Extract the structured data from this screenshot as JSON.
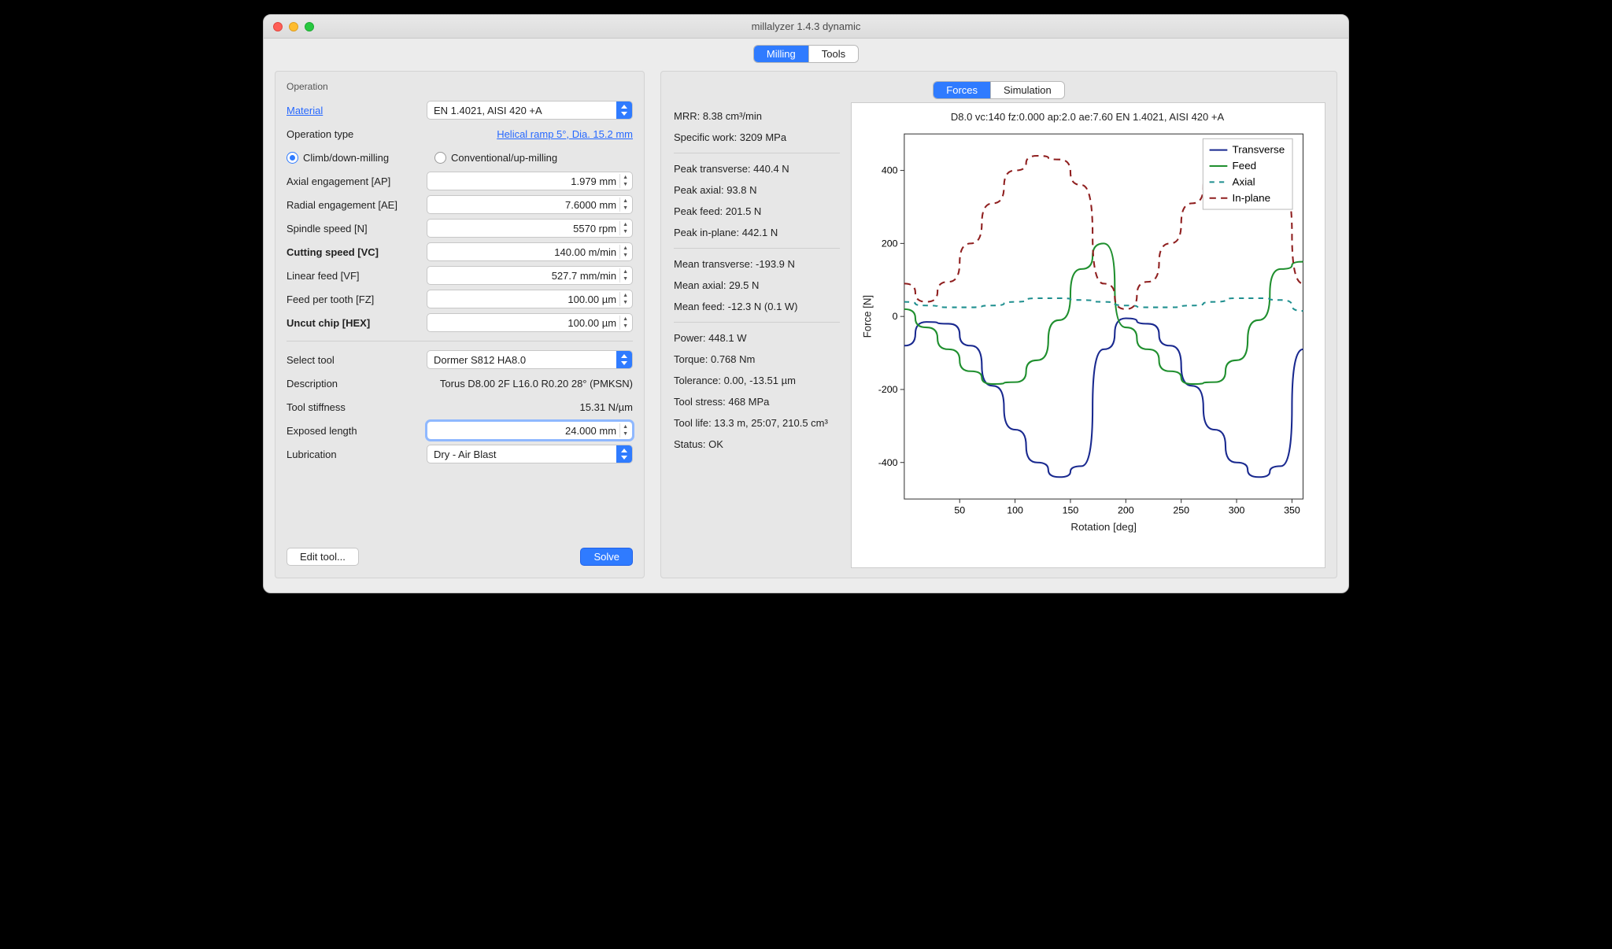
{
  "window": {
    "title": "millalyzer 1.4.3 dynamic"
  },
  "main_tabs": {
    "milling": "Milling",
    "tools": "Tools"
  },
  "sub_tabs": {
    "forces": "Forces",
    "simulation": "Simulation"
  },
  "section": {
    "operation": "Operation"
  },
  "left": {
    "material_label": "Material",
    "material_value": "EN 1.4021, AISI 420 +A",
    "op_type_label": "Operation type",
    "op_type_link": "Helical ramp 5°, Dia. 15.2 mm",
    "radio_climb": "Climb/down-milling",
    "radio_conventional": "Conventional/up-milling",
    "ap_label": "Axial engagement [AP]",
    "ap_value": "1.979 mm",
    "ae_label": "Radial engagement [AE]",
    "ae_value": "7.6000 mm",
    "n_label": "Spindle speed [N]",
    "n_value": "5570 rpm",
    "vc_label": "Cutting speed [VC]",
    "vc_value": "140.00 m/min",
    "vf_label": "Linear feed [VF]",
    "vf_value": "527.7 mm/min",
    "fz_label": "Feed per tooth [FZ]",
    "fz_value": "100.00 µm",
    "hex_label": "Uncut chip [HEX]",
    "hex_value": "100.00 µm",
    "select_tool_label": "Select tool",
    "select_tool_value": "Dormer S812 HA8.0",
    "desc_label": "Description",
    "desc_value": "Torus D8.00 2F L16.0 R0.20 28° (PMKSN)",
    "stiffness_label": "Tool stiffness",
    "stiffness_value": "15.31 N/µm",
    "exposed_label": "Exposed length",
    "exposed_value": "24.000 mm",
    "lub_label": "Lubrication",
    "lub_value": "Dry - Air Blast",
    "edit_tool_btn": "Edit tool...",
    "solve_btn": "Solve"
  },
  "stats": {
    "mrr": "MRR: 8.38 cm³/min",
    "spec_work": "Specific work: 3209 MPa",
    "peak_trans": "Peak transverse: 440.4 N",
    "peak_axial": "Peak axial: 93.8 N",
    "peak_feed": "Peak feed: 201.5 N",
    "peak_inplane": "Peak in-plane: 442.1 N",
    "mean_trans": "Mean transverse: -193.9 N",
    "mean_axial": "Mean axial: 29.5 N",
    "mean_feed": "Mean feed: -12.3 N (0.1 W)",
    "power": "Power: 448.1 W",
    "torque": "Torque: 0.768 Nm",
    "tolerance": "Tolerance: 0.00, -13.51 µm",
    "tool_stress": "Tool stress: 468 MPa",
    "tool_life": "Tool life: 13.3 m, 25:07, 210.5 cm³",
    "status": "Status: OK"
  },
  "chart": {
    "title": "D8.0 vc:140 fz:0.000 ap:2.0 ae:7.60 EN 1.4021, AISI 420 +A",
    "xlabel": "Rotation [deg]",
    "ylabel": "Force [N]",
    "legend": {
      "transverse": "Transverse",
      "feed": "Feed",
      "axial": "Axial",
      "inplane": "In-plane"
    }
  },
  "chart_data": {
    "type": "line",
    "xlabel": "Rotation [deg]",
    "ylabel": "Force [N]",
    "xlim": [
      0,
      360
    ],
    "ylim": [
      -500,
      500
    ],
    "xticks": [
      50,
      100,
      150,
      200,
      250,
      300,
      350
    ],
    "yticks": [
      -400,
      -200,
      0,
      200,
      400
    ],
    "x": [
      0,
      20,
      40,
      60,
      80,
      100,
      120,
      140,
      160,
      180,
      200,
      220,
      240,
      260,
      280,
      300,
      320,
      340,
      360
    ],
    "series": [
      {
        "name": "Transverse",
        "color": "#19298f",
        "dash": "",
        "values": [
          -80,
          -15,
          -20,
          -80,
          -190,
          -310,
          -400,
          -440,
          -410,
          -90,
          -5,
          -20,
          -80,
          -190,
          -310,
          -400,
          -440,
          -410,
          -90
        ]
      },
      {
        "name": "Feed",
        "color": "#1f8f2e",
        "dash": "",
        "values": [
          20,
          -30,
          -90,
          -150,
          -185,
          -180,
          -120,
          -10,
          130,
          200,
          -30,
          -90,
          -150,
          -185,
          -180,
          -120,
          -10,
          130,
          150
        ]
      },
      {
        "name": "Axial",
        "color": "#1f8f8f",
        "dash": "6 6",
        "values": [
          40,
          30,
          25,
          25,
          30,
          40,
          50,
          50,
          45,
          40,
          30,
          25,
          25,
          30,
          40,
          50,
          50,
          45,
          15
        ]
      },
      {
        "name": "In-plane",
        "color": "#8f1f1f",
        "dash": "8 6",
        "values": [
          90,
          40,
          95,
          200,
          310,
          400,
          440,
          430,
          360,
          90,
          20,
          95,
          200,
          310,
          400,
          440,
          430,
          360,
          90
        ]
      }
    ]
  }
}
